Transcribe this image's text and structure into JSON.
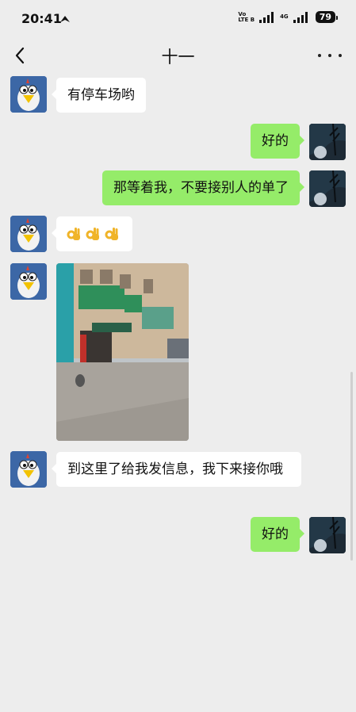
{
  "status_bar": {
    "time": "20:41",
    "network_label_top": "Vo",
    "network_label_bottom": "LTE B",
    "network_4g": "4G",
    "battery": "79"
  },
  "header": {
    "title": "十一"
  },
  "messages": [
    {
      "side": "in",
      "text": "有停车场哟"
    },
    {
      "side": "out",
      "text": "好的"
    },
    {
      "side": "out",
      "text": "那等着我，不要接别人的单了"
    },
    {
      "side": "in",
      "emoji": "ok-hand ok-hand ok-hand"
    },
    {
      "side": "in",
      "image": "street-photo"
    },
    {
      "side": "in",
      "text": "到这里了给我发信息，我下来接你哦"
    },
    {
      "side": "out",
      "text": "好的"
    }
  ],
  "colors": {
    "background": "#ededed",
    "outgoing_bubble": "#95ec69",
    "incoming_bubble": "#ffffff"
  }
}
